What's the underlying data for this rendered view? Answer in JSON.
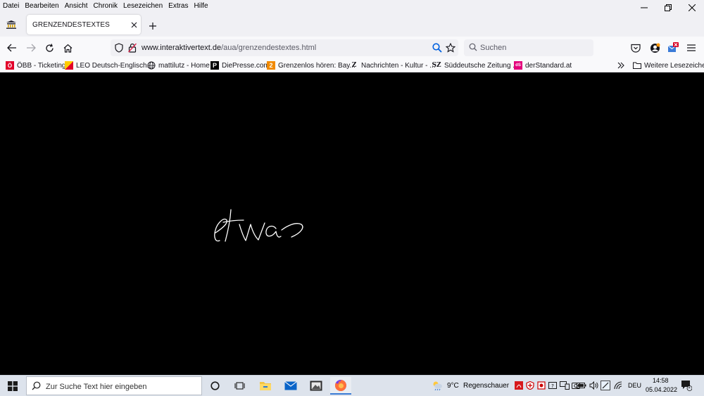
{
  "menubar": {
    "items": [
      "Datei",
      "Bearbeiten",
      "Ansicht",
      "Chronik",
      "Lesezeichen",
      "Extras",
      "Hilfe"
    ]
  },
  "tab": {
    "title": "GRENZENDESTEXTES"
  },
  "url": {
    "host": "www.interaktivertext.de",
    "path": "/aua/grenzendestextes.html"
  },
  "search": {
    "placeholder": "Suchen"
  },
  "bookmarks": [
    {
      "label": "ÖBB - Ticketing",
      "icon": "obb-icon"
    },
    {
      "label": "LEO Deutsch-Englisch...",
      "icon": "leo-icon"
    },
    {
      "label": "mattilutz - Home",
      "icon": "globe-icon"
    },
    {
      "label": "DiePresse.com",
      "icon": "diepresse-icon"
    },
    {
      "label": "Grenzenlos hören: Bay...",
      "icon": "br-icon"
    },
    {
      "label": "Nachrichten - Kultur - ...",
      "icon": "zeit-icon"
    },
    {
      "label": "Süddeutsche Zeitung ...",
      "icon": "sz-icon"
    },
    {
      "label": "derStandard.at",
      "icon": "derstandard-icon"
    }
  ],
  "bookmarks_more": {
    "label": "Weitere Lesezeichen"
  },
  "content": {
    "handwritten_word": "etwas"
  },
  "taskbar": {
    "search_placeholder": "Zur Suche Text hier eingeben",
    "weather_temp": "9°C",
    "weather_text": "Regenschauer",
    "language": "DEU",
    "time": "14:58",
    "date": "05.04.2022",
    "notification_count": "1"
  },
  "colors": {
    "accent_blue": "#0060df",
    "page_background": "#000000",
    "taskbar": "#dde3ec"
  }
}
